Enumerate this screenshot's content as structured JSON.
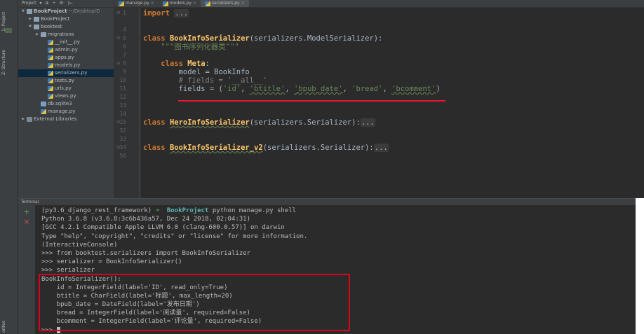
{
  "left_strip": {
    "project_label": "1: Project",
    "structure_label": "Z: Structure",
    "favorites_label": "orites"
  },
  "project_panel": {
    "header_title": "Project",
    "header_controls": [
      "▾",
      "⊕",
      "÷",
      "⚙·",
      "|←"
    ],
    "tree": [
      {
        "label": "BookProject",
        "hint": "~/Desktop/D",
        "indent": 0,
        "arrow": "▼",
        "icon": "folder",
        "bold": true
      },
      {
        "label": "BookProject",
        "hint": "",
        "indent": 1,
        "arrow": "▶",
        "icon": "folder"
      },
      {
        "label": "booktest",
        "hint": "",
        "indent": 1,
        "arrow": "▼",
        "icon": "folder"
      },
      {
        "label": "migrations",
        "hint": "",
        "indent": 2,
        "arrow": "▶",
        "icon": "folder"
      },
      {
        "label": "__init__.py",
        "hint": "",
        "indent": 3,
        "arrow": "",
        "icon": "py"
      },
      {
        "label": "admin.py",
        "hint": "",
        "indent": 3,
        "arrow": "",
        "icon": "py"
      },
      {
        "label": "apps.py",
        "hint": "",
        "indent": 3,
        "arrow": "",
        "icon": "py"
      },
      {
        "label": "models.py",
        "hint": "",
        "indent": 3,
        "arrow": "",
        "icon": "py"
      },
      {
        "label": "serializers.py",
        "hint": "",
        "indent": 3,
        "arrow": "",
        "icon": "py",
        "selected": true
      },
      {
        "label": "tests.py",
        "hint": "",
        "indent": 3,
        "arrow": "",
        "icon": "py"
      },
      {
        "label": "urls.py",
        "hint": "",
        "indent": 3,
        "arrow": "",
        "icon": "py"
      },
      {
        "label": "views.py",
        "hint": "",
        "indent": 3,
        "arrow": "",
        "icon": "py"
      },
      {
        "label": "db.sqlite3",
        "hint": "",
        "indent": 2,
        "arrow": "",
        "icon": "db"
      },
      {
        "label": "manage.py",
        "hint": "",
        "indent": 2,
        "arrow": "",
        "icon": "py"
      },
      {
        "label": "External Libraries",
        "hint": "",
        "indent": 0,
        "arrow": "▶",
        "icon": "lib"
      }
    ]
  },
  "tabs": [
    {
      "label": "manage.py",
      "close": "×",
      "active": false
    },
    {
      "label": "models.py",
      "close": "×",
      "active": false
    },
    {
      "label": "serializers.py",
      "close": "×",
      "active": true
    }
  ],
  "editor": {
    "line_numbers": [
      "1",
      "4",
      "5",
      "6",
      "7",
      "8",
      "9",
      "10",
      "11",
      "12",
      "13",
      "14",
      "15",
      "32",
      "33",
      "34",
      "56"
    ],
    "import_kw": "import",
    "import_fold": "...",
    "class_kw": "class",
    "serializer1_name": "BookInfoSerializer",
    "serializer1_base": "(serializers.ModelSerializer):",
    "docstring": "\"\"\"图书序列化器类\"\"\"",
    "meta_class_name": "Meta",
    "meta_colon": ":",
    "model_line": "model = BookInfo",
    "fields_comment": "# fields = '__all__'",
    "fields_prefix": "fields = (",
    "field_names": [
      "'id'",
      "'btitle'",
      "'bpub_date'",
      "'bread'",
      "'bcomment'"
    ],
    "field_sep": ", ",
    "fields_suffix": ")",
    "hero_name": "HeroInfoSerializer",
    "hero_base": "(serializers.Serializer):",
    "serializer2_name": "BookInfoSerializer_v2",
    "serializer2_base": "(serializers.Serializer):",
    "fold_marker": "..."
  },
  "terminal": {
    "title": "Terminal",
    "plus_icon": "+",
    "close_icon": "×",
    "prompt_env": "(py3.6_django_rest_framework)",
    "prompt_arrow": "➜",
    "prompt_project": "BookProject",
    "prompt_cmd": "python manage.py shell",
    "lines": [
      "Python 3.6.8 (v3.6.8:3c6b436a57, Dec 24 2018, 02:04:31)",
      "[GCC 4.2.1 Compatible Apple LLVM 6.0 (clang-600.0.57)] on darwin",
      "Type \"help\", \"copyright\", \"credits\" or \"license\" for more information.",
      "(InteractiveConsole)",
      ">>> from booktest.serializers import BookInfoSerializer",
      ">>> serializer = BookInfoSerializer()",
      ">>> serializer",
      "BookInfoSerializer():",
      "    id = IntegerField(label='ID', read_only=True)",
      "    btitle = CharField(label='标题', max_length=20)",
      "    bpub_date = DateField(label='发布日期')",
      "    bread = IntegerField(label='阅读量', required=False)",
      "    bcomment = IntegerField(label='评论量', required=False)"
    ],
    "final_prompt": ">>> "
  },
  "colors": {
    "highlight": "#e8162e",
    "editor_bg": "#2b2b2b",
    "keyword": "#cc7832",
    "string": "#6a8759",
    "class_name": "#ffc66d"
  }
}
